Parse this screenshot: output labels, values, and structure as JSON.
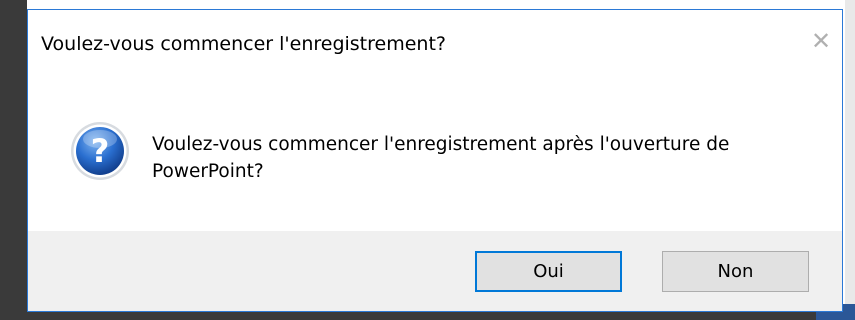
{
  "dialog": {
    "title": "Voulez-vous commencer l'enregistrement?",
    "message": "Voulez-vous commencer l'enregistrement après l'ouverture de\nPowerPoint?",
    "icon": "question-icon",
    "close_glyph": "✕",
    "buttons": {
      "yes_label": "Oui",
      "no_label": "Non"
    }
  },
  "colors": {
    "accent": "#0078d7",
    "icon_blue": "#1f5fb8"
  }
}
